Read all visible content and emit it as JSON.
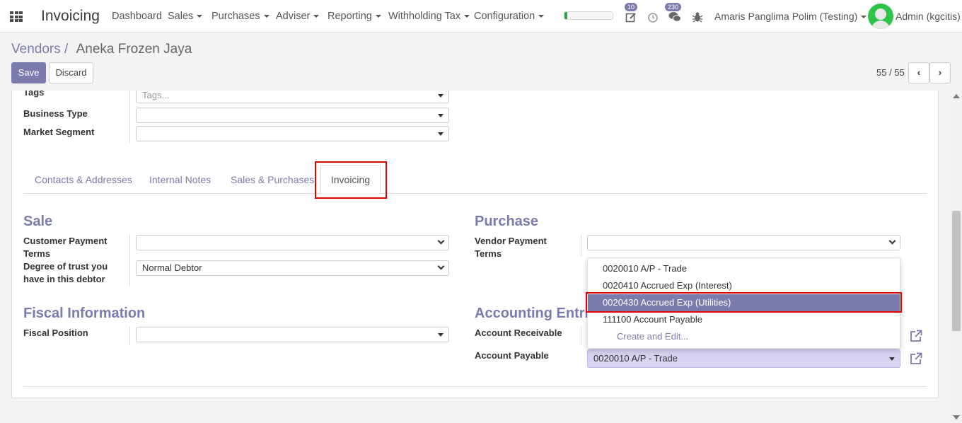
{
  "header": {
    "app_title": "Invoicing",
    "menu": [
      {
        "label": "Dashboard",
        "dropdown": false
      },
      {
        "label": "Sales",
        "dropdown": true
      },
      {
        "label": "Purchases",
        "dropdown": true
      },
      {
        "label": "Adviser",
        "dropdown": true
      },
      {
        "label": "Reporting",
        "dropdown": true
      },
      {
        "label": "Withholding Tax",
        "dropdown": true
      },
      {
        "label": "Configuration",
        "dropdown": true
      }
    ],
    "progress_fraction": 0.06,
    "activity_badge": "10",
    "messages_badge": "230",
    "company": "Amaris Panglima Polim (Testing)",
    "user": "Admin (kgcitis)",
    "accent_color": "#7c7bad"
  },
  "breadcrumb": {
    "parent": "Vendors",
    "separator": "/",
    "current": "Aneka Frozen Jaya"
  },
  "controls": {
    "save": "Save",
    "discard": "Discard",
    "pager": "55 / 55"
  },
  "fields": {
    "tags_label": "Tags",
    "tags_placeholder": "Tags...",
    "business_type_label": "Business Type",
    "business_type_value": "",
    "market_segment_label": "Market Segment",
    "market_segment_value": ""
  },
  "tabs": [
    {
      "label": "Contacts & Addresses",
      "active": false
    },
    {
      "label": "Internal Notes",
      "active": false
    },
    {
      "label": "Sales & Purchases",
      "active": false
    },
    {
      "label": "Invoicing",
      "active": true
    }
  ],
  "sale": {
    "title": "Sale",
    "customer_payment_terms_label_1": "Customer Payment",
    "customer_payment_terms_label_2": "Terms",
    "customer_payment_terms_value": "",
    "trust_label_1": "Degree of trust you",
    "trust_label_2": "have in this debtor",
    "trust_value": "Normal Debtor"
  },
  "purchase": {
    "title": "Purchase",
    "vendor_payment_terms_label_1": "Vendor Payment",
    "vendor_payment_terms_label_2": "Terms",
    "vendor_payment_terms_value": ""
  },
  "fiscal": {
    "title": "Fiscal Information",
    "position_label": "Fiscal Position",
    "position_value": ""
  },
  "accounting": {
    "title": "Accounting Entri",
    "receivable_label": "Account Receivable",
    "payable_label": "Account Payable",
    "payable_value": "0020010 A/P - Trade"
  },
  "dropdown": {
    "options": [
      {
        "label": "0020010 A/P - Trade",
        "highlighted": false
      },
      {
        "label": "0020410 Accrued Exp (Interest)",
        "highlighted": false
      },
      {
        "label": "0020430 Accrued Exp (Utilities)",
        "highlighted": true
      },
      {
        "label": "111100 Account Payable",
        "highlighted": false
      }
    ],
    "create_edit": "Create and Edit..."
  }
}
